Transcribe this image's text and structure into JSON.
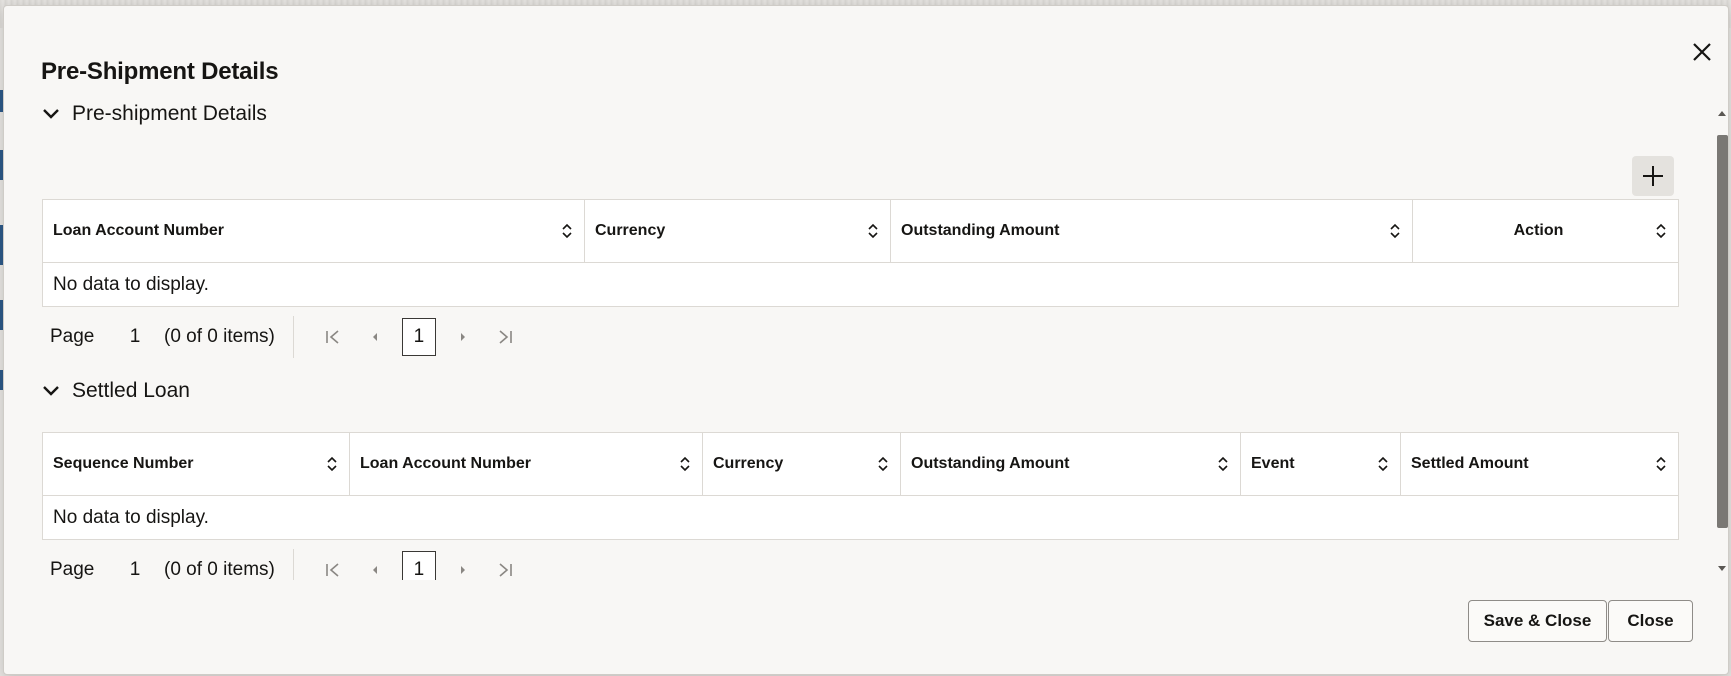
{
  "dialog": {
    "title": "Pre-Shipment Details",
    "close_icon": "close-icon"
  },
  "preshipment": {
    "section_title": "Pre-shipment Details",
    "add_icon": "plus-icon",
    "columns": [
      "Loan Account Number",
      "Currency",
      "Outstanding Amount",
      "Action"
    ],
    "empty_text": "No data to display.",
    "pager": {
      "page_label": "Page",
      "page_value": "1",
      "items_text": "(0 of 0 items)",
      "current_page": "1"
    }
  },
  "settled": {
    "section_title": "Settled Loan",
    "columns": [
      "Sequence Number",
      "Loan Account Number",
      "Currency",
      "Outstanding Amount",
      "Event",
      "Settled Amount"
    ],
    "empty_text": "No data to display.",
    "pager": {
      "page_label": "Page",
      "page_value": "1",
      "items_text": "(0 of 0 items)",
      "current_page": "1"
    }
  },
  "footer": {
    "save_close_label": "Save & Close",
    "close_label": "Close"
  },
  "colors": {
    "dialog_bg": "#f8f7f5",
    "text": "#161513",
    "border": "#dcd9d4"
  }
}
